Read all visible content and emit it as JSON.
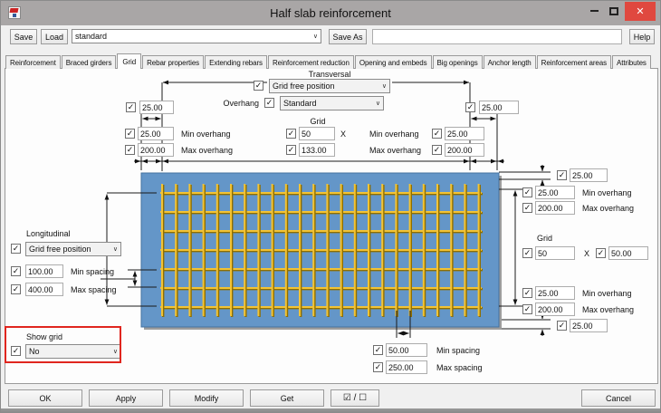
{
  "window": {
    "title": "Half slab reinforcement"
  },
  "icons": {
    "check": "✓",
    "chevron": "∨",
    "close": "✕"
  },
  "toolbar": {
    "save": "Save",
    "load": "Load",
    "preset_value": "standard",
    "save_as": "Save As",
    "name_value": "",
    "help": "Help"
  },
  "tabs": {
    "active_index": 2,
    "items": [
      "Reinforcement",
      "Braced girders",
      "Grid",
      "Rebar properties",
      "Extending rebars",
      "Reinforcement reduction",
      "Opening and embeds",
      "Big openings",
      "Anchor length",
      "Reinforcement areas",
      "Attributes"
    ]
  },
  "transversal": {
    "section_label": "Transversal",
    "position_value": "Grid free position",
    "overhang_label": "Overhang",
    "overhang_mode_value": "Standard",
    "left_edge_value": "25.00",
    "right_edge_value": "25.00",
    "grid_label": "Grid",
    "min_overhang_left": {
      "value": "25.00",
      "label": "Min overhang"
    },
    "max_overhang_left": {
      "value": "200.00",
      "label": "Max overhang"
    },
    "grid_x_value": "50",
    "grid_sep": "X",
    "grid_y_value": "133.00",
    "min_overhang_right": {
      "value": "25.00",
      "label": "Min overhang"
    },
    "max_overhang_right": {
      "value": "200.00",
      "label": "Max overhang"
    }
  },
  "longitudinal": {
    "section_label": "Longitudinal",
    "position_value": "Grid free position",
    "min_spacing": {
      "value": "100.00",
      "label": "Min spacing"
    },
    "max_spacing": {
      "value": "400.00",
      "label": "Max spacing"
    }
  },
  "show_grid": {
    "section_label": "Show grid",
    "value": "No"
  },
  "right_panel": {
    "top_edge_value": "25.00",
    "min_overhang_top": {
      "value": "25.00",
      "label": "Min overhang"
    },
    "max_overhang_top": {
      "value": "200.00",
      "label": "Max overhang"
    },
    "grid_label": "Grid",
    "grid_x_value": "50",
    "grid_sep": "X",
    "grid_y_value": "50.00",
    "min_overhang_bottom": {
      "value": "25.00",
      "label": "Min overhang"
    },
    "max_overhang_bottom": {
      "value": "200.00",
      "label": "Max overhang"
    },
    "bottom_edge_value": "25.00"
  },
  "bottom_panel": {
    "min_spacing": {
      "value": "50.00",
      "label": "Min spacing"
    },
    "max_spacing": {
      "value": "250.00",
      "label": "Max spacing"
    }
  },
  "footer": {
    "ok": "OK",
    "apply": "Apply",
    "modify": "Modify",
    "get": "Get",
    "toggle": "☑ / ☐",
    "cancel": "Cancel"
  },
  "colors": {
    "slab_fill": "#6496c8",
    "slab_border": "#44719f",
    "mesh_line": "#f2c335",
    "mesh_shadow": "#8f6f00",
    "highlight_box": "#e0261f",
    "titlebar": "#a9a6a6",
    "close_button": "#e0483f"
  }
}
